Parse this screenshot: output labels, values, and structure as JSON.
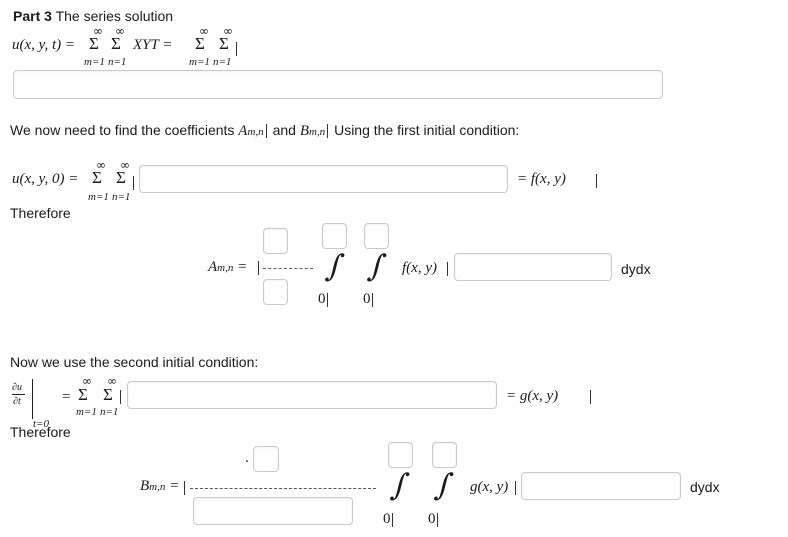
{
  "part3": {
    "label": "Part 3",
    "title": "The series solution",
    "lhs": "u(x, y, t) =",
    "sum_sym": "Σ",
    "inf_sym": "∞",
    "m_idx": "m=1",
    "n_idx": "n=1",
    "product": "XYT =",
    "answer_value": ""
  },
  "coeff_text": {
    "before": "We now need to find the coefficients",
    "A": "A",
    "A_sub": "m,n",
    "and": "and",
    "B": "B",
    "B_sub": "m,n",
    "after": "Using the first initial condition:"
  },
  "first_ic": {
    "lhs": "u(x, y, 0) =",
    "rhs": "= f(x, y)",
    "series_value": ""
  },
  "therefore1": "Therefore",
  "A_formula": {
    "A": "A",
    "A_sub": "m,n",
    "eq": "=",
    "fxy": "f(x, y)",
    "lower1": "0",
    "lower2": "0",
    "dydx": "dydx",
    "integrand_value": ""
  },
  "second_ic_text": "Now we use the second initial condition:",
  "second_ic": {
    "du": "∂u",
    "dt": "∂t",
    "eval": "t=0",
    "eq": "=",
    "rhs": "= g(x, y)",
    "series_value": ""
  },
  "therefore2": "Therefore",
  "B_formula": {
    "B": "B",
    "B_sub": "m,n",
    "eq": "=",
    "dot": ".",
    "gxy": "g(x, y)",
    "lower1": "0",
    "lower2": "0",
    "dydx": "dydx",
    "integrand_value": ""
  }
}
